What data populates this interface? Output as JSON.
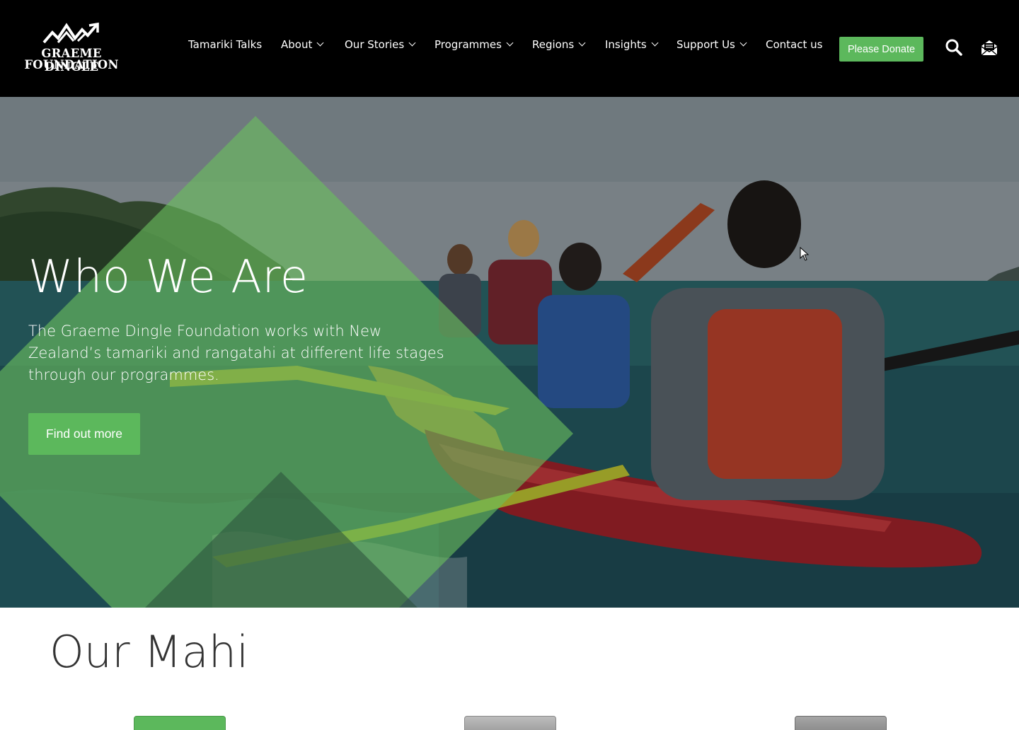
{
  "header": {
    "logo": {
      "line1": "GRAEME DINGLE",
      "line2": "FOUNDATION",
      "icon": "mountain-arrows-logo"
    },
    "nav": [
      {
        "label": "Tamariki Talks",
        "has_dropdown": false
      },
      {
        "label": "About",
        "has_dropdown": true
      },
      {
        "label": "Our Stories",
        "has_dropdown": true
      },
      {
        "label": "Programmes",
        "has_dropdown": true
      },
      {
        "label": "Regions",
        "has_dropdown": true
      },
      {
        "label": "Insights",
        "has_dropdown": true
      },
      {
        "label": "Support Us",
        "has_dropdown": true
      },
      {
        "label": "Contact us",
        "has_dropdown": false
      }
    ],
    "donate_label": "Please Donate",
    "icons": [
      "search-icon",
      "mail-icon"
    ]
  },
  "hero": {
    "title": "Who We Are",
    "text": "The Graeme Dingle Foundation works with New Zealand’s tamariki and rangatahi at different life stages through our programmes.",
    "button_label": "Find out more"
  },
  "mahi": {
    "title": "Our Mahi"
  },
  "colors": {
    "header_bg": "#000000",
    "accent_green": "#5cb85c",
    "text_dark": "#333333"
  }
}
